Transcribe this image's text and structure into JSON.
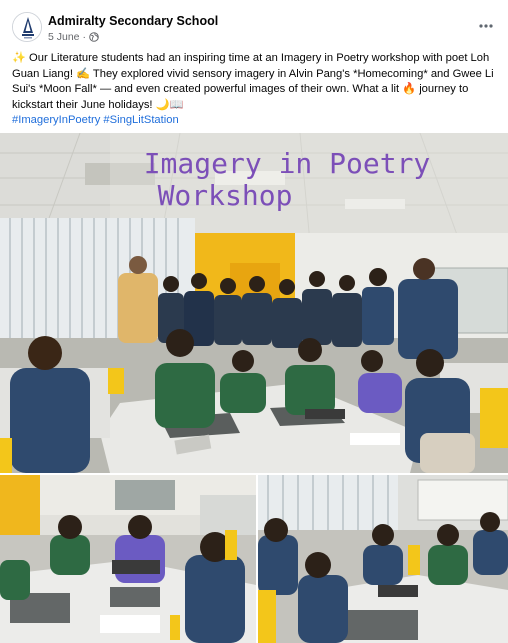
{
  "post": {
    "page_name": "Admiralty Secondary School",
    "date": "5 June",
    "date_separator": "·",
    "visibility_icon": "globe-icon",
    "more_icon": "more-options-icon",
    "text_lines": [
      "✨ Our Literature students had an inspiring time at an Imagery in Poetry workshop with poet Loh",
      "Guan Liang! ✍️ They explored vivid sensory imagery in Alvin Pang's *Homecoming* and Gwee Li",
      "Sui's *Moon Fall* — and even created powerful images of their own. What a lit 🔥 journey to",
      "kickstart their June holidays! 🌙📖"
    ],
    "hashtags": [
      "#ImageryInPoetry",
      "#SingLitStation"
    ]
  },
  "photos": {
    "main": {
      "whiteboard_line1": "Imagery in Poetry",
      "whiteboard_line2": "Workshop"
    },
    "bottom_left_icon": "photo-icon",
    "bottom_right_icon": "photo-icon"
  },
  "colors": {
    "hashtag": "#216fdb",
    "meta_text": "#65676b",
    "whiteboard_text": "#7c4fb8",
    "school_uniform": "#2f4a6e",
    "school_green": "#2e6a43",
    "chair_yellow": "#f3c61a"
  }
}
